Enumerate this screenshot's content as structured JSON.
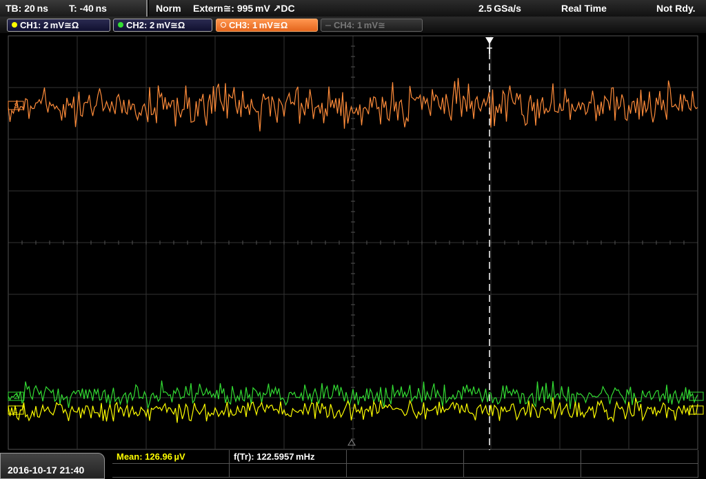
{
  "timebase": {
    "tb": "TB: 20 ns",
    "t": "T: -40 ns"
  },
  "trigger": {
    "mode": "Norm",
    "source": "Extern≅: 995 mV ↗DC",
    "sample_rate": "2.5 GSa/s",
    "acq_mode": "Real Time",
    "status": "Not Rdy."
  },
  "channels": [
    {
      "label": "CH1: 2 mV≅Ω",
      "color": "#ffff00",
      "active": true
    },
    {
      "label": "CH2: 2 mV≅Ω",
      "color": "#33dd33",
      "active": true
    },
    {
      "label": "CH3: 1 mV≅Ω",
      "color": "#ff8c3a",
      "active": true
    },
    {
      "label": "CH4: 1 mV≅",
      "color": "#666666",
      "active": false
    }
  ],
  "markers": {
    "ch1": "1",
    "ch2": "2",
    "ch3": "3",
    "trigger": "T"
  },
  "measurements": {
    "mean": "Mean: 126.96 µV",
    "freq": "f(Tr): 122.5957 mHz"
  },
  "datetime": "2016-10-17  21:40",
  "colors": {
    "ch1": "#ffff00",
    "ch2": "#33dd33",
    "ch3": "#ff8c3a",
    "grid": "#3a3a3a",
    "mean_text": "#ffff00"
  }
}
